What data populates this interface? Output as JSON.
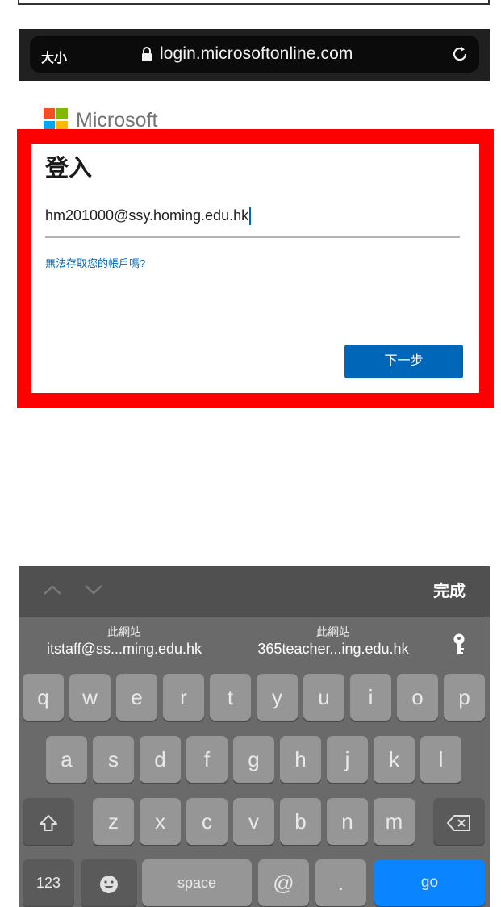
{
  "browser": {
    "text_size_label": "大小",
    "url": "login.microsoftonline.com"
  },
  "brand": {
    "name": "Microsoft",
    "colors": [
      "#f25022",
      "#7fba00",
      "#00a4ef",
      "#ffb900"
    ]
  },
  "signin": {
    "title": "登入",
    "email_value": "hm201000@ssy.homing.edu.hk",
    "cant_access_link": "無法存取您的帳戶嗎?",
    "next_button": "下一步",
    "highlight_color": "#ff0000",
    "accent_color": "#0067b8"
  },
  "keyboard": {
    "done_label": "完成",
    "suggestions": [
      {
        "source": "此網站",
        "value": "itstaff@ss...ming.edu.hk"
      },
      {
        "source": "此網站",
        "value": "365teacher...ing.edu.hk"
      }
    ],
    "rows": [
      [
        "q",
        "w",
        "e",
        "r",
        "t",
        "y",
        "u",
        "i",
        "o",
        "p"
      ],
      [
        "a",
        "s",
        "d",
        "f",
        "g",
        "h",
        "j",
        "k",
        "l"
      ],
      [
        "z",
        "x",
        "c",
        "v",
        "b",
        "n",
        "m"
      ]
    ],
    "numbers_key": "123",
    "space_key": "space",
    "at_key": "@",
    "dot_key": ".",
    "go_key": "go",
    "icons": {
      "shift": "shift-icon",
      "backspace": "backspace-icon",
      "emoji": "emoji-icon",
      "passwords": "key-icon",
      "prev_field": "chevron-up-icon",
      "next_field": "chevron-down-icon"
    }
  }
}
